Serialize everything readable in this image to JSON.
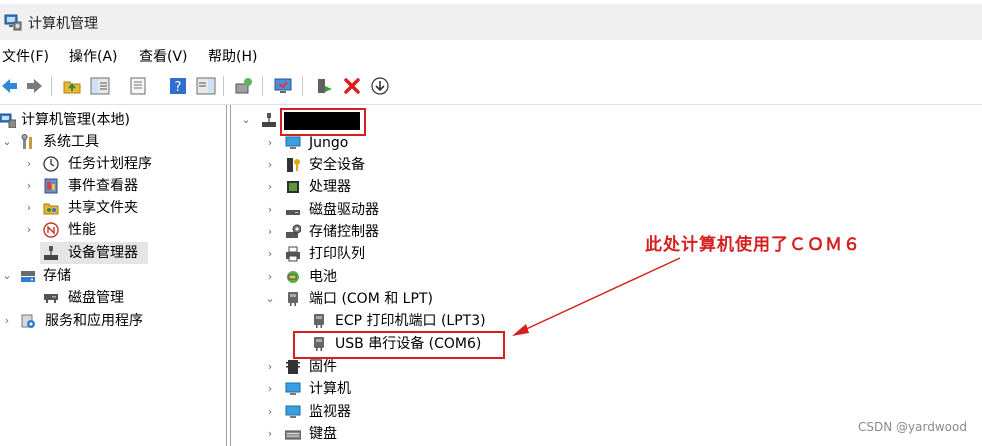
{
  "window": {
    "title": "计算机管理"
  },
  "menubar": {
    "items": [
      "文件(F)",
      "操作(A)",
      "查看(V)",
      "帮助(H)"
    ]
  },
  "toolbar": {
    "buttons": [
      "back-icon",
      "forward-icon",
      "up-folder-icon",
      "show-hide-tree-icon",
      "properties-icon",
      "help-icon",
      "action-pane-icon",
      "scan-hardware-icon",
      "monitor-icon",
      "enable-device-icon",
      "uninstall-icon",
      "update-driver-icon"
    ]
  },
  "left_tree": {
    "items": [
      {
        "label": "计算机管理(本地)",
        "icon": "computer-management-icon"
      },
      {
        "label": "系统工具",
        "icon": "system-tools-icon"
      },
      {
        "label": "任务计划程序",
        "icon": "clock-icon"
      },
      {
        "label": "事件查看器",
        "icon": "event-viewer-icon"
      },
      {
        "label": "共享文件夹",
        "icon": "shared-folder-icon"
      },
      {
        "label": "性能",
        "icon": "performance-icon"
      },
      {
        "label": "设备管理器",
        "icon": "device-manager-icon"
      },
      {
        "label": "存储",
        "icon": "storage-icon"
      },
      {
        "label": "磁盘管理",
        "icon": "disk-management-icon"
      },
      {
        "label": "服务和应用程序",
        "icon": "services-icon"
      }
    ]
  },
  "device_tree": {
    "items": [
      {
        "label": "Jungo",
        "icon": "jungo-icon"
      },
      {
        "label": "安全设备",
        "icon": "security-device-icon"
      },
      {
        "label": "处理器",
        "icon": "processor-icon"
      },
      {
        "label": "磁盘驱动器",
        "icon": "disk-drive-icon"
      },
      {
        "label": "存储控制器",
        "icon": "storage-controller-icon"
      },
      {
        "label": "打印队列",
        "icon": "printer-icon"
      },
      {
        "label": "电池",
        "icon": "battery-icon"
      },
      {
        "label": "端口 (COM 和 LPT)",
        "icon": "port-icon"
      },
      {
        "label": "ECP 打印机端口 (LPT3)",
        "icon": "port-icon"
      },
      {
        "label": "USB 串行设备 (COM6)",
        "icon": "port-icon"
      },
      {
        "label": "固件",
        "icon": "firmware-icon"
      },
      {
        "label": "计算机",
        "icon": "computer-icon"
      },
      {
        "label": "监视器",
        "icon": "monitor-icon"
      },
      {
        "label": "键盘",
        "icon": "keyboard-icon"
      }
    ]
  },
  "annotation": {
    "text": "此处计算机使用了ＣＯＭ６",
    "color": "#d62020"
  },
  "watermark": {
    "text": "CSDN @yardwood"
  }
}
